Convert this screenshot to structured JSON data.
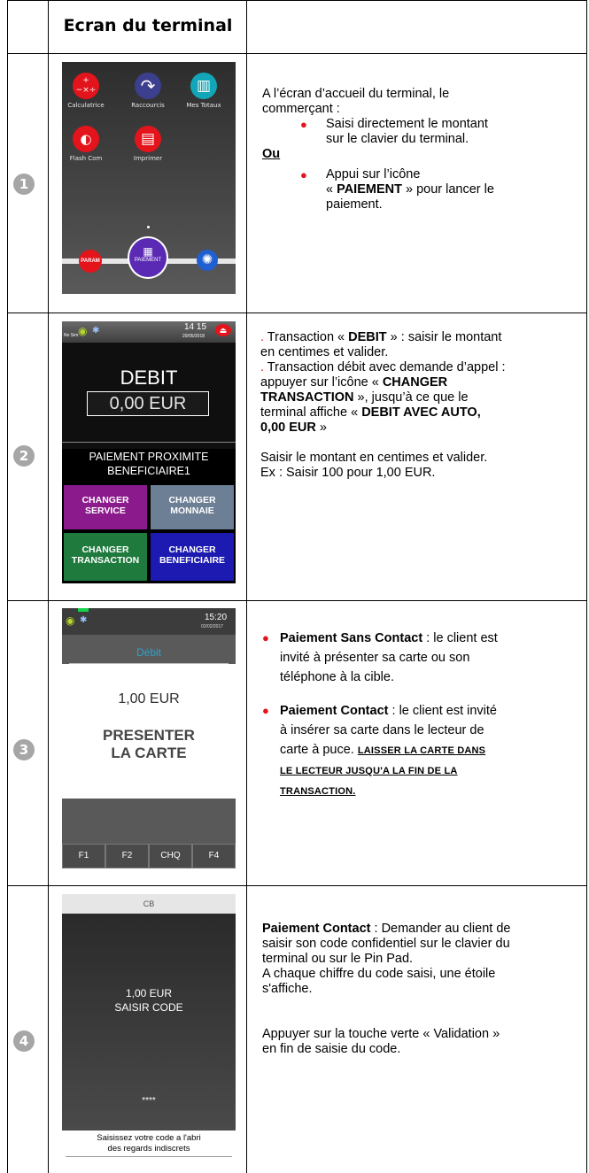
{
  "header": {
    "title": "Ecran du terminal"
  },
  "steps": [
    "1",
    "2",
    "3",
    "4"
  ],
  "screen1": {
    "icons": [
      {
        "name": "calculator-icon",
        "glyph": "+−×÷",
        "label": "Calculatrice"
      },
      {
        "name": "shortcut-icon",
        "glyph": "↷",
        "label": "Raccourcis"
      },
      {
        "name": "totals-icon",
        "glyph": "▥",
        "label": "Mes Totaux"
      },
      {
        "name": "flash-com-icon",
        "glyph": "◐",
        "label": "Flash Com"
      },
      {
        "name": "printer-icon",
        "glyph": "▤",
        "label": "Imprimer"
      }
    ],
    "param_label": "PARAM",
    "paiement_label": "PAIEMENT",
    "colors": {
      "red": "#e3141b",
      "purple": "#5b2ab5",
      "blue": "#1f5fd0",
      "teal": "#12a6b8"
    }
  },
  "screen2": {
    "status_left": "No Sim",
    "time": "14 15",
    "date": "29/05/2018",
    "title": "DEBIT",
    "amount": "0,00 EUR",
    "service_line1": "PAIEMENT PROXIMITE",
    "service_line2": "BENEFICIAIRE1",
    "buttons": [
      {
        "line1": "CHANGER",
        "line2": "SERVICE",
        "color": "#8b1a8c"
      },
      {
        "line1": "CHANGER",
        "line2": "MONNAIE",
        "color": "#6d7f95"
      },
      {
        "line1": "CHANGER",
        "line2": "TRANSACTION",
        "color": "#1f7a3d"
      },
      {
        "line1": "CHANGER",
        "line2": "BENEFICIAIRE",
        "color": "#1c1ab0"
      }
    ]
  },
  "screen3": {
    "time": "15:20",
    "date": "02/02/2017",
    "title": "Débit",
    "amount": "1,00 EUR",
    "prompt_line1": "PRESENTER",
    "prompt_line2": "LA CARTE",
    "fkeys": [
      "F1",
      "F2",
      "CHQ",
      "F4"
    ]
  },
  "screen4": {
    "header": "CB",
    "amount": "1,00 EUR",
    "prompt": "SAISIR CODE",
    "stars": "****",
    "footer_line1": "Saisissez votre code a l'abri",
    "footer_line2": "des regards indiscrets"
  },
  "row1": {
    "intro_line1": "A l’écran d’accueil du terminal, le",
    "intro_line2": "commerçant :",
    "b1_line1": "Saisi directement le montant",
    "b1_line2": "sur le clavier du terminal.",
    "ou": "Ou",
    "b2_line1": "Appui sur l’icône",
    "b2_pre": "« ",
    "b2_bold": "PAIEMENT",
    "b2_post": " » pour lancer le",
    "b2_line3": "paiement."
  },
  "row2": {
    "p1_a": ". ",
    "p1_b": "Transaction « ",
    "p1_bold": "DEBIT",
    "p1_c": " » : saisir le montant",
    "p1_line2": "en centimes et valider.",
    "p2_a": ". ",
    "p2_line1": "Transaction débit avec demande d’appel :",
    "p2_line2_pre": "appuyer sur l’icône « ",
    "p2_line2_bold": "CHANGER",
    "p2_line3_bold": "TRANSACTION",
    "p2_line3_post": " », jusqu’à ce que le",
    "p2_line4_pre": "terminal affiche « ",
    "p2_line4_bold": "DEBIT AVEC AUTO,",
    "p2_line5_bold": "0,00 EUR",
    "p2_line5_post": " »",
    "p3_line1": "Saisir le montant en centimes et valider.",
    "p3_line2": "Ex : Saisir 100 pour 1,00 EUR."
  },
  "row3": {
    "b1_bold": "Paiement Sans Contact",
    "b1_line1": " : le client est",
    "b1_line2": "invité à présenter sa carte ou son",
    "b1_line3": "téléphone à la cible.",
    "b2_bold": "Paiement Contact",
    "b2_line1": " : le client est invité",
    "b2_line2": "à insérer sa carte dans le lecteur de",
    "b2_line3": "carte à puce. ",
    "b2_caps1": "LAISSER LA CARTE DANS",
    "b2_caps2": "LE LECTEUR JUSQU'A LA FIN DE LA",
    "b2_caps3": "TRANSACTION."
  },
  "row4": {
    "p1_bold": "Paiement Contact",
    "p1_line1": " : Demander au client de",
    "p1_line2": "saisir son code confidentiel sur le clavier du",
    "p1_line3": "terminal ou sur le Pin Pad.",
    "p2_line1": "A chaque chiffre du code saisi, une étoile",
    "p2_line2": "s'affiche.",
    "p3_line1": "Appuyer sur la touche verte « Validation »",
    "p3_line2": "en fin de saisie du code."
  }
}
